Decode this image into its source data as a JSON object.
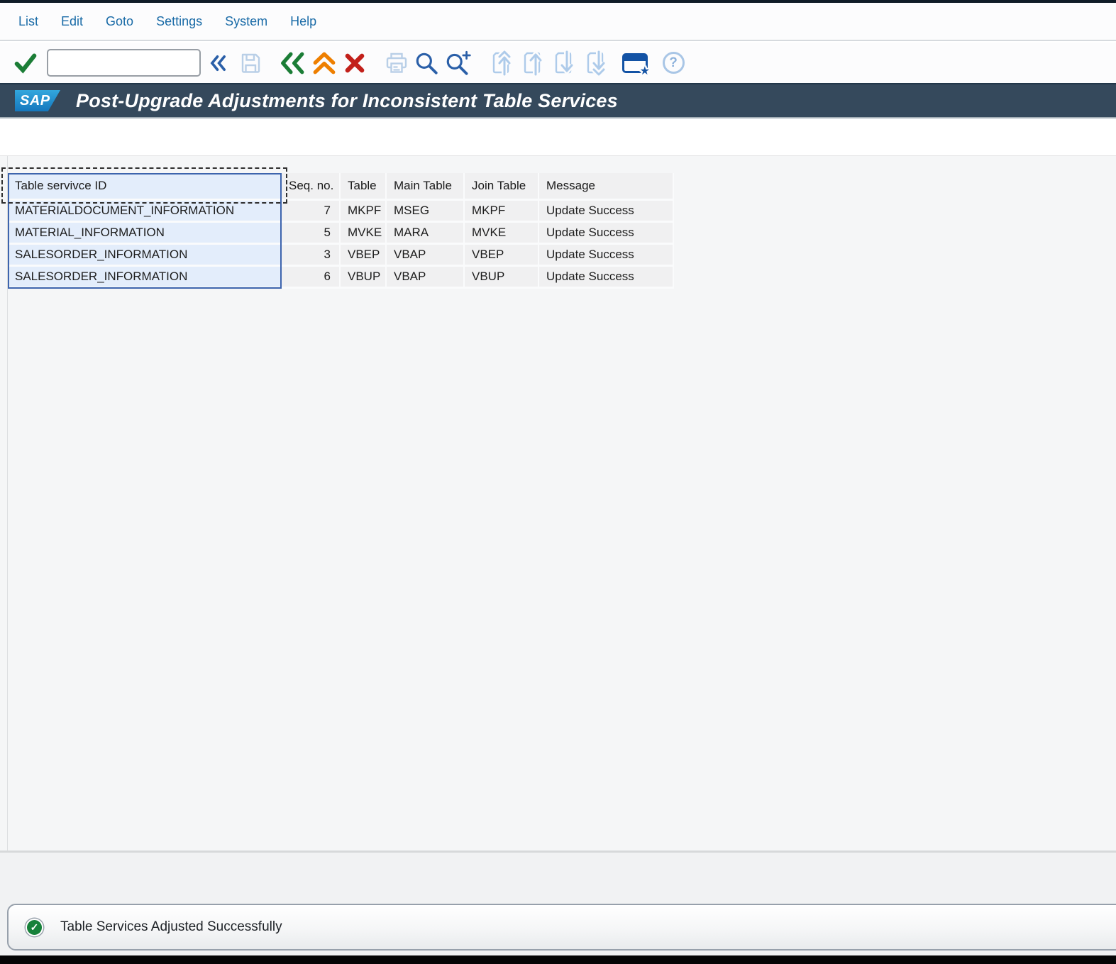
{
  "menu_bar": {
    "items": [
      "List",
      "Edit",
      "Goto",
      "Settings",
      "System",
      "Help"
    ]
  },
  "toolbar": {
    "command_field": {
      "value": "",
      "placeholder": ""
    },
    "icons": [
      "enter-check",
      "collapse-left",
      "save",
      "back",
      "exit-up",
      "cancel",
      "print",
      "find",
      "find-next",
      "first-page",
      "page-up",
      "page-down",
      "last-page",
      "create-shortcut",
      "help"
    ],
    "glyphs": {
      "help": "?",
      "star": "★",
      "success_check": "✓"
    }
  },
  "header": {
    "logo_text": "SAP",
    "title": "Post-Upgrade Adjustments for Inconsistent Table Services"
  },
  "table": {
    "columns": [
      "Table servivce ID",
      "Seq. no.",
      "Table",
      "Main Table",
      "Join Table",
      "Message"
    ],
    "rows": [
      [
        "MATERIALDOCUMENT_INFORMATION",
        "7",
        "MKPF",
        "MSEG",
        "MKPF",
        "Update Success"
      ],
      [
        "MATERIAL_INFORMATION",
        "5",
        "MVKE",
        "MARA",
        "MVKE",
        "Update Success"
      ],
      [
        "SALESORDER_INFORMATION",
        "3",
        "VBEP",
        "VBAP",
        "VBEP",
        "Update Success"
      ],
      [
        "SALESORDER_INFORMATION",
        "6",
        "VBUP",
        "VBAP",
        "VBUP",
        "Update Success"
      ]
    ],
    "selected_column": "Table servivce ID"
  },
  "status_bar": {
    "icon": "success-check",
    "message": "Table Services Adjusted Successfully"
  },
  "colors": {
    "title_bar_bg": "#35495C",
    "menu_text": "#1A6BA7",
    "logo_blue": "#2096D5",
    "success_green": "#1B7D36",
    "exit_orange": "#EE7F00",
    "cancel_red": "#C2201A",
    "icon_blue": "#2A5FA8",
    "icon_disabled": "#AECBEA",
    "selected_col_bg": "#E3EDFB",
    "selected_col_border": "#3D64AD",
    "cell_bg": "#F0F0F1",
    "panel_bg": "#F5F6F7"
  }
}
